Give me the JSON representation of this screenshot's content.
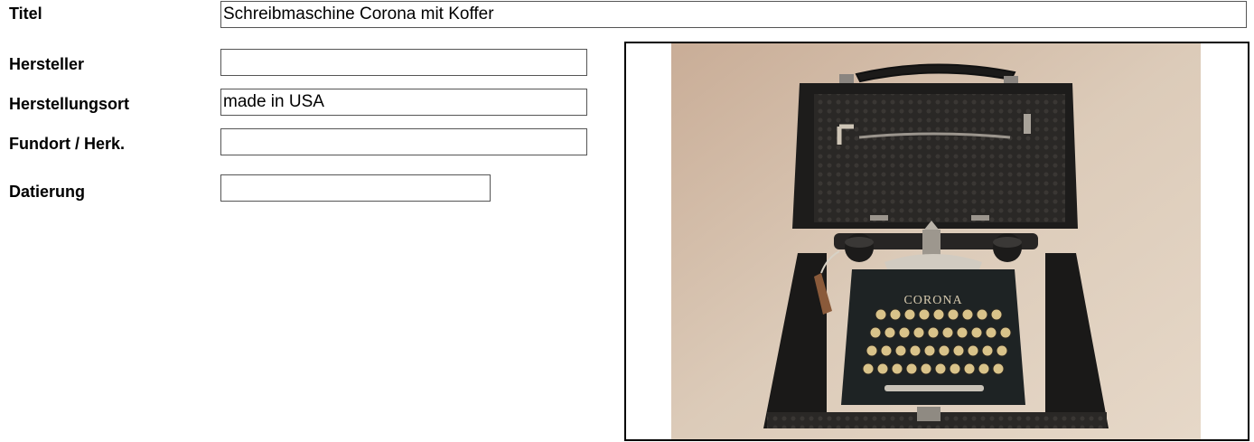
{
  "form": {
    "fields": [
      {
        "label": "Titel",
        "value": "Schreibmaschine Corona mit Koffer"
      },
      {
        "label": "Hersteller",
        "value": ""
      },
      {
        "label": "Herstellungsort",
        "value": "made in USA"
      },
      {
        "label": "Fundort / Herk.",
        "value": ""
      },
      {
        "label": "Datierung",
        "value": ""
      }
    ]
  },
  "photo": {
    "subject": "Corona typewriter in open case",
    "brand_text": "CORONA",
    "colors": {
      "backdrop": "#d8c6b4",
      "case": "#1f1d1b",
      "keys": "#d9c38a"
    }
  }
}
